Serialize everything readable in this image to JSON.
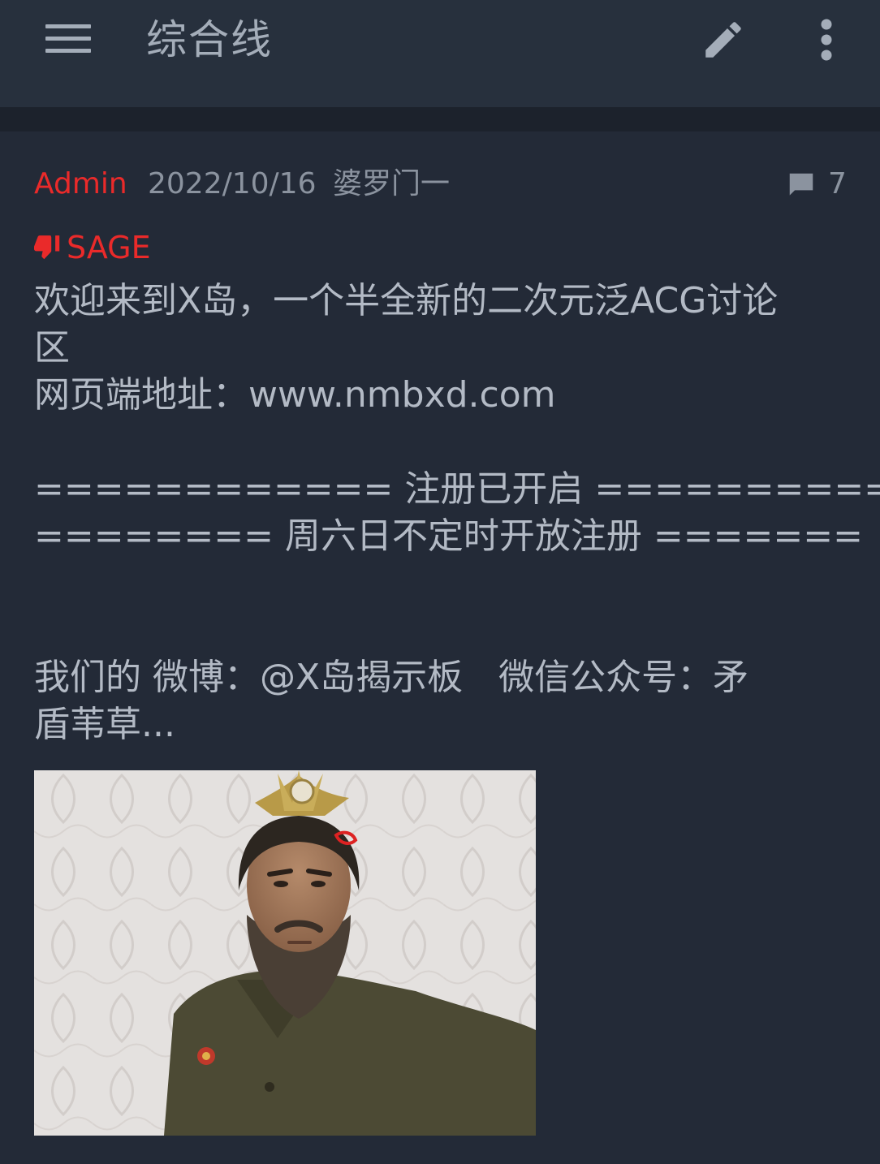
{
  "toolbar": {
    "title": "综合线",
    "menu_icon": "hamburger-menu-icon",
    "edit_icon": "pencil-edit-icon",
    "more_icon": "more-vertical-icon"
  },
  "post": {
    "user": "Admin",
    "date": "2022/10/16",
    "thread_name": "婆罗门一",
    "reply_count": "7",
    "reply_icon": "comment-bubble-icon",
    "sage_label": "SAGE",
    "sage_icon": "thumbs-down-icon",
    "content_lines": [
      "欢迎来到X岛，一个半全新的二次元泛ACG讨论",
      "区",
      "网页端地址：www.nmbxd.com",
      "",
      "============ 注册已开启 ===========",
      "======== 周六日不定时开放注册 =======",
      "",
      "",
      "我们的 微博：@X岛揭示板　微信公众号：矛",
      "盾苇草..."
    ],
    "image_alt": "photo of a bearded man in an olive uniform wearing a golden headpiece"
  },
  "colors": {
    "background": "#232a37",
    "toolbar": "#27303d",
    "accent_red": "#ea2a2a",
    "muted_text": "#8b939f",
    "body_text": "#b3bac5"
  }
}
